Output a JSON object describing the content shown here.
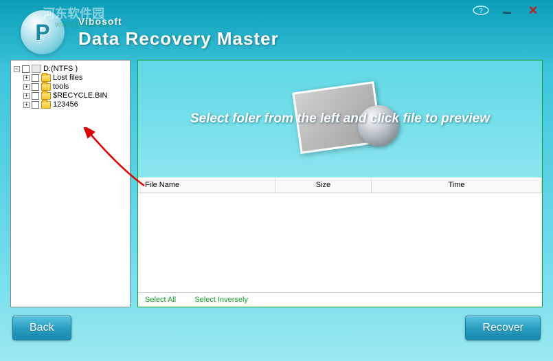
{
  "watermark": {
    "text1": "河东软件园",
    "text2": "www.pc0359.cn"
  },
  "header": {
    "brand": "Vibosoft",
    "product": "Data Recovery Master"
  },
  "tree": {
    "root": {
      "label": "D:(NTFS )"
    },
    "items": [
      {
        "label": "Lost files"
      },
      {
        "label": "tools"
      },
      {
        "label": "$RECYCLE.BIN"
      },
      {
        "label": "123456"
      }
    ]
  },
  "preview": {
    "hint": "Select  foler from the left and click file to preview"
  },
  "table": {
    "columns": {
      "name": "File Name",
      "size": "Size",
      "time": "Time"
    }
  },
  "selectbar": {
    "all": "Select All",
    "inverse": "Select Inversely"
  },
  "footer": {
    "back": "Back",
    "recover": "Recover"
  },
  "titlebar": {
    "question": "?",
    "minimize": "−",
    "close": "×"
  }
}
